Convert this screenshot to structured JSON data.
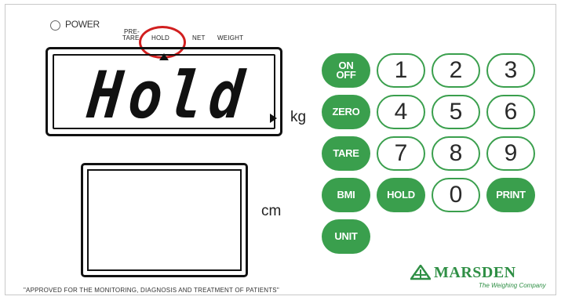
{
  "power": {
    "label": "POWER"
  },
  "annunciators": {
    "pretare_line1": "PRE-",
    "pretare_line2": "TARE",
    "hold": "HOLD",
    "net": "NET",
    "weight": "WEIGHT"
  },
  "weight_display": {
    "reading": "Hold",
    "unit": "kg"
  },
  "height_display": {
    "unit": "cm"
  },
  "keypad": {
    "on_off_line1": "ON",
    "on_off_line2": "OFF",
    "zero": "ZERO",
    "tare": "TARE",
    "bmi": "BMI",
    "hold": "HOLD",
    "print": "PRINT",
    "unit": "UNIT",
    "digits": [
      "1",
      "2",
      "3",
      "4",
      "5",
      "6",
      "7",
      "8",
      "9",
      "0"
    ]
  },
  "footer": {
    "text": "\"APPROVED FOR THE MONITORING, DIAGNOSIS AND TREATMENT OF PATIENTS\""
  },
  "brand": {
    "name": "MARSDEN",
    "tagline": "The Weighing Company"
  },
  "colors": {
    "accent_green": "#3a9f4d",
    "highlight_red": "#d11f1f"
  },
  "icons": {
    "power_indicator": "power-led-icon",
    "brand_mark": "marsden-logo-icon",
    "hold_pointer": "triangle-up-icon",
    "lcd_pointer": "triangle-right-icon"
  }
}
